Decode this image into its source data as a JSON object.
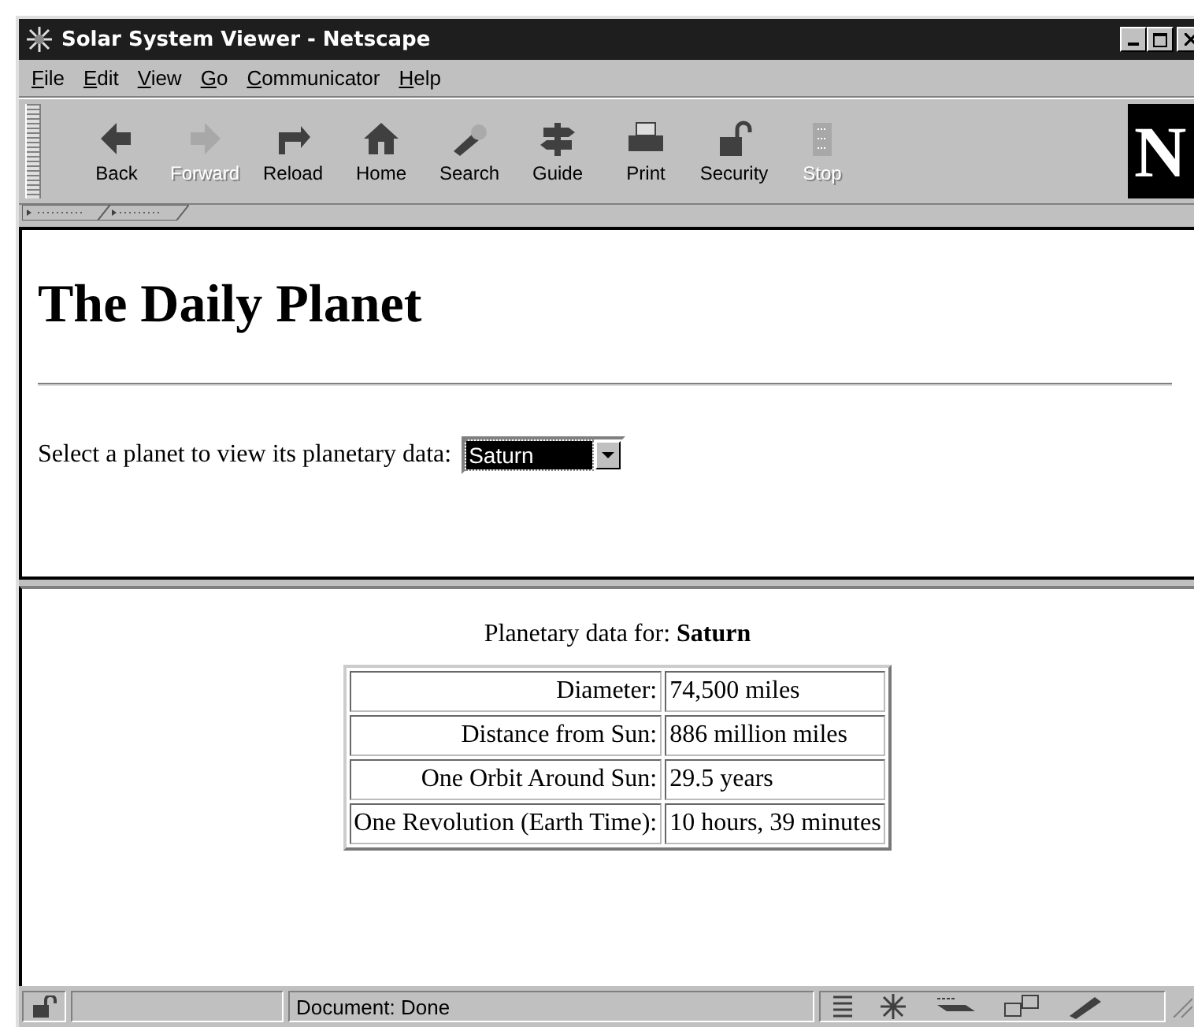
{
  "window": {
    "title": "Solar System Viewer - Netscape"
  },
  "menu": [
    "File",
    "Edit",
    "View",
    "Go",
    "Communicator",
    "Help"
  ],
  "toolbar": [
    {
      "label": "Back",
      "disabled": false
    },
    {
      "label": "Forward",
      "disabled": true
    },
    {
      "label": "Reload",
      "disabled": false
    },
    {
      "label": "Home",
      "disabled": false
    },
    {
      "label": "Search",
      "disabled": false
    },
    {
      "label": "Guide",
      "disabled": false
    },
    {
      "label": "Print",
      "disabled": false
    },
    {
      "label": "Security",
      "disabled": false
    },
    {
      "label": "Stop",
      "disabled": true
    }
  ],
  "logo": "N",
  "top_frame": {
    "heading": "The Daily Planet",
    "prompt": "Select a planet to view its planetary data:",
    "planet_select": {
      "value": "Saturn",
      "focused": true
    }
  },
  "bottom_frame": {
    "caption": "Planetary data for: **Saturn**",
    "rows": [
      {
        "label": "Diameter:",
        "value": "74,500 miles"
      },
      {
        "label": "Distance from Sun:",
        "value": "886 million miles"
      },
      {
        "label": "One Orbit Around Sun:",
        "value": "29.5 years"
      },
      {
        "label": "One Revolution (Earth Time):",
        "value": "10 hours, 39 minutes"
      }
    ]
  },
  "status_bar": {
    "progress": {
      "level": 0
    },
    "text": "Document: Done"
  }
}
